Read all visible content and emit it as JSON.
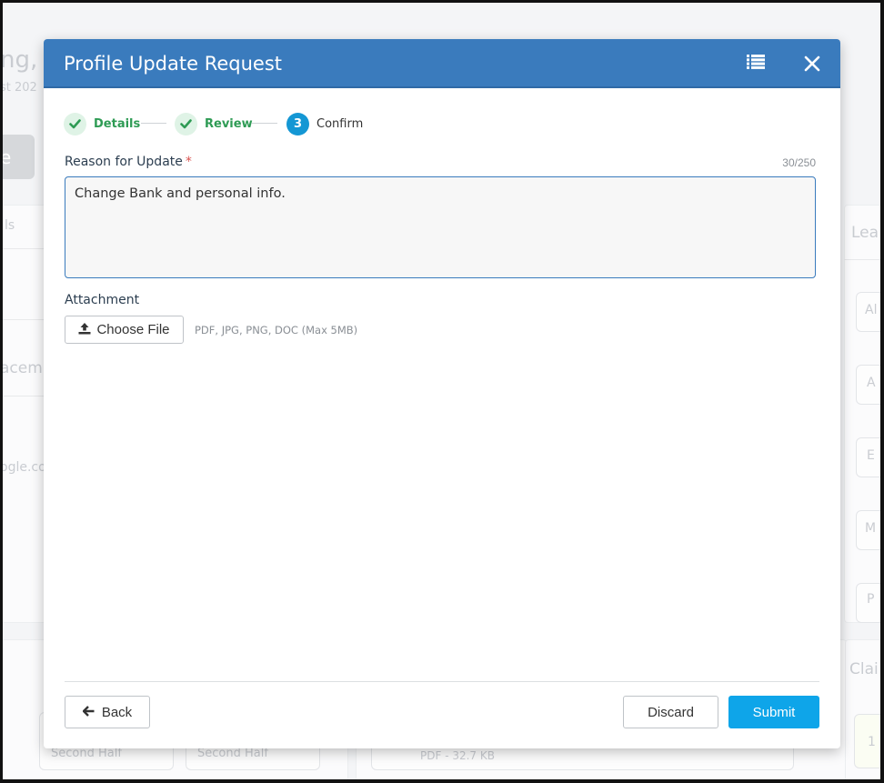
{
  "modal": {
    "title": "Profile Update Request"
  },
  "steps": [
    {
      "number": "1",
      "label": "Details",
      "state": "done"
    },
    {
      "number": "2",
      "label": "Review",
      "state": "done"
    },
    {
      "number": "3",
      "label": "Confirm",
      "state": "active"
    }
  ],
  "reason": {
    "label": "Reason for Update",
    "required_mark": "*",
    "counter": "30/250",
    "value": "Change Bank and personal info."
  },
  "attachment": {
    "label": "Attachment",
    "button_label": "Choose File",
    "hint": "PDF, JPG, PNG, DOC (Max 5MB)"
  },
  "footer": {
    "back_label": "Back",
    "discard_label": "Discard",
    "submit_label": "Submit"
  },
  "background": {
    "fragments": [
      "ng,",
      "st 202",
      "e",
      "ls",
      "acem",
      "ogle.co",
      "Lea",
      "Al",
      "A",
      "E",
      "M",
      "P",
      "Clai",
      "1",
      "Second Half",
      "Second Half",
      "PDF - 32.7 KB"
    ]
  },
  "colors": {
    "header": "#3a7bbd",
    "success": "#2e9b54",
    "step_active": "#1497d4",
    "submit": "#0ea5e9",
    "required": "#d9534f"
  },
  "icons": {
    "header_list": "list-icon",
    "header_close": "close-icon",
    "step_done": "check-icon",
    "upload": "upload-icon",
    "back": "arrow-left-icon"
  }
}
